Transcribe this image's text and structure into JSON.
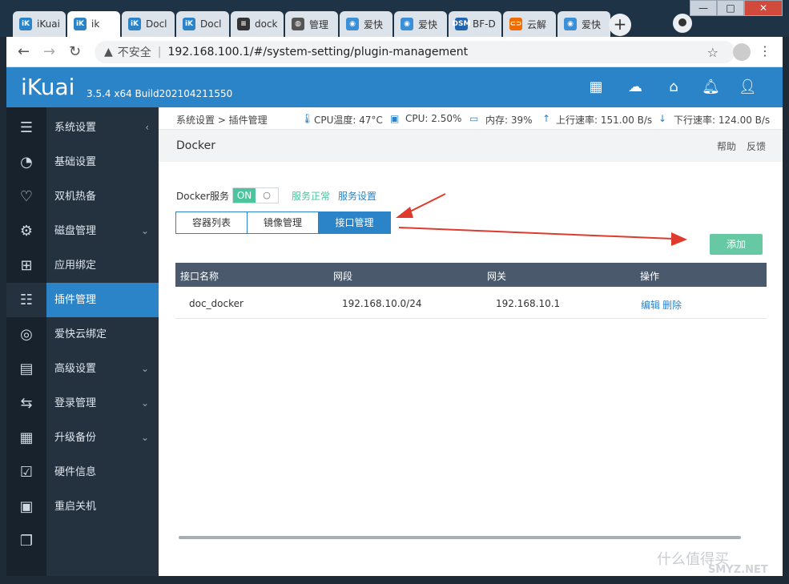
{
  "browser": {
    "tabs": [
      {
        "label": "iKuai",
        "icon": "ikuai-icon",
        "color": "#2b84c8"
      },
      {
        "label": "ik",
        "icon": "ikuai-icon",
        "color": "#2b84c8",
        "active": true
      },
      {
        "label": "Docl",
        "icon": "ikuai-icon",
        "color": "#2b84c8"
      },
      {
        "label": "Docl",
        "icon": "ikuai-icon",
        "color": "#2b84c8"
      },
      {
        "label": "dock",
        "icon": "docker-icon",
        "color": "#333333"
      },
      {
        "label": "管理",
        "icon": "globe-icon",
        "color": "#555555"
      },
      {
        "label": "爱快",
        "icon": "ikuai-round-icon",
        "color": "#3a8fd6"
      },
      {
        "label": "爱快",
        "icon": "ikuai-round-icon",
        "color": "#3a8fd6"
      },
      {
        "label": "BF-D",
        "icon": "dsm-icon",
        "color": "#2164b0"
      },
      {
        "label": "云解",
        "icon": "cloud-dns-icon",
        "color": "#ef6c00"
      },
      {
        "label": "爱快",
        "icon": "ikuai-round-icon",
        "color": "#3a8fd6"
      }
    ],
    "new_tab": "+",
    "insecure_label": "不安全",
    "url": "192.168.100.1/#/system-setting/plugin-management"
  },
  "header": {
    "logo": "iKuai",
    "version": "3.5.4 x64 Build202104211550"
  },
  "sidebar": {
    "items": [
      {
        "label": "系统设置",
        "icon": "menu-collapse-icon",
        "chevron": "‹"
      },
      {
        "label": "基础设置",
        "icon": "speedometer-icon"
      },
      {
        "label": "双机热备",
        "icon": "heartbeat-icon"
      },
      {
        "label": "磁盘管理",
        "icon": "gear-icon",
        "chevron": "⌄"
      },
      {
        "label": "应用绑定",
        "icon": "network-tree-icon"
      },
      {
        "label": "插件管理",
        "icon": "sliders-icon",
        "active": true
      },
      {
        "label": "爱快云绑定",
        "icon": "wifi-icon"
      },
      {
        "label": "高级设置",
        "icon": "id-card-icon",
        "chevron": "⌄"
      },
      {
        "label": "登录管理",
        "icon": "swap-arrows-icon",
        "chevron": "⌄"
      },
      {
        "label": "升级备份",
        "icon": "brick-wall-icon",
        "chevron": "⌄"
      },
      {
        "label": "硬件信息",
        "icon": "checklist-icon"
      },
      {
        "label": "重启关机",
        "icon": "grid-apps-icon"
      },
      {
        "label": "",
        "icon": "copy-icon"
      }
    ]
  },
  "status": {
    "breadcrumb": "系统设置 > 插件管理",
    "cpu_temp": "CPU温度: 47°C",
    "cpu": "CPU: 2.50%",
    "memory": "内存: 39%",
    "upload": "上行速率: 151.00 B/s",
    "download": "下行速率: 124.00 B/s"
  },
  "page": {
    "title": "Docker",
    "help": "帮助",
    "feedback": "反馈",
    "service_label": "Docker服务",
    "toggle_on": "ON",
    "toggle_off": "○",
    "service_ok": "服务正常",
    "service_settings": "服务设置",
    "tabs": [
      "容器列表",
      "镜像管理",
      "接口管理"
    ],
    "add_button": "添加"
  },
  "table": {
    "headers": [
      "接口名称",
      "网段",
      "网关",
      "操作"
    ],
    "rows": [
      {
        "name": "doc_docker",
        "subnet": "192.168.10.0/24",
        "gateway": "192.168.10.1",
        "edit": "编辑",
        "delete": "删除"
      }
    ]
  },
  "watermark": {
    "text1": "什么值得买",
    "text2": "SMYZ.NET"
  },
  "colors": {
    "accent": "#2b84c8",
    "success": "#4ec49c",
    "sidebar": "#24313f",
    "arrow": "#e03a2e"
  }
}
